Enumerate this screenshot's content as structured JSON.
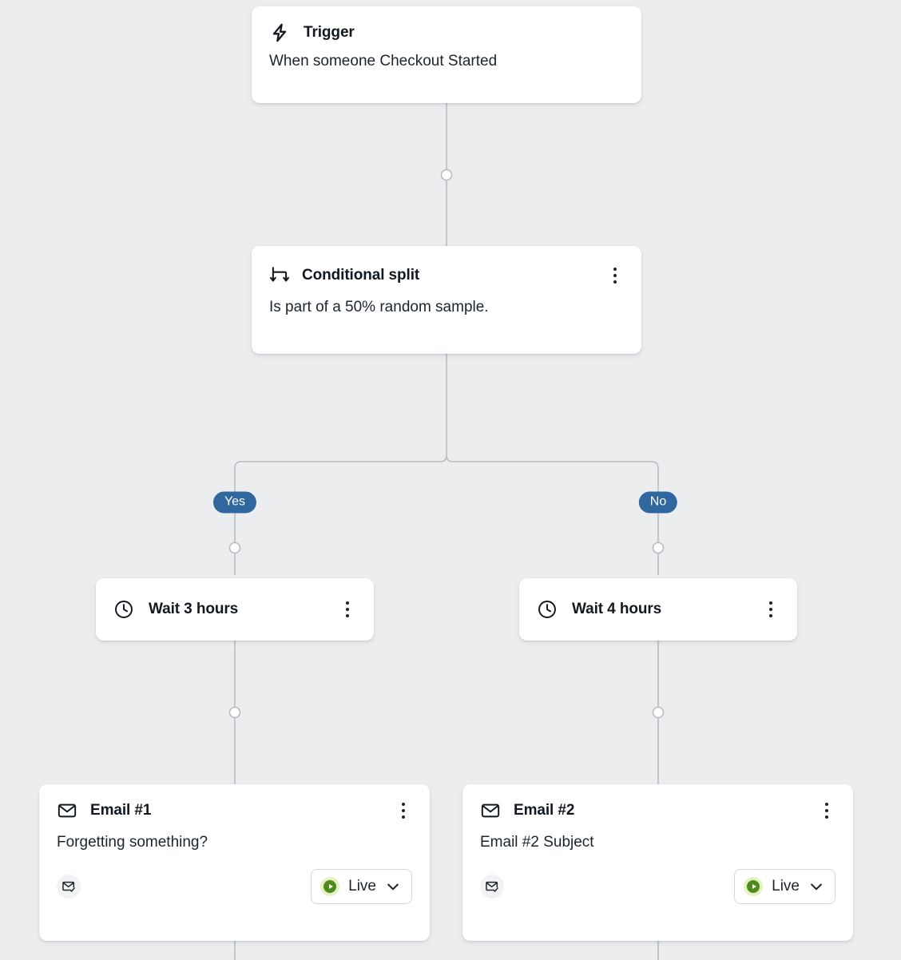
{
  "canvas": {
    "background_color": "#ebedef",
    "accent_blue": "#31679f",
    "status_green": "#4f8a1e",
    "status_green_halo": "#e4f2c2",
    "line_color": "#b9bcc2"
  },
  "nodes": {
    "trigger": {
      "icon": "lightning-bolt-icon",
      "title": "Trigger",
      "body": "When someone Checkout Started"
    },
    "conditional_split": {
      "icon": "split-arrows-icon",
      "title": "Conditional split",
      "body": "Is part of a 50% random sample.",
      "menu": "kebab-menu"
    },
    "wait_left": {
      "icon": "clock-icon",
      "title": "Wait 3 hours",
      "menu": "kebab-menu"
    },
    "wait_right": {
      "icon": "clock-icon",
      "title": "Wait 4 hours",
      "menu": "kebab-menu"
    },
    "email_1": {
      "icon": "envelope-icon",
      "title": "Email #1",
      "subject": "Forgetting something?",
      "status_icon": "envelope-check-icon",
      "status_label": "Live",
      "menu": "kebab-menu"
    },
    "email_2": {
      "icon": "envelope-icon",
      "title": "Email #2",
      "subject": "Email #2 Subject",
      "status_icon": "envelope-check-icon",
      "status_label": "Live",
      "menu": "kebab-menu"
    }
  },
  "branches": {
    "yes_label": "Yes",
    "no_label": "No"
  }
}
